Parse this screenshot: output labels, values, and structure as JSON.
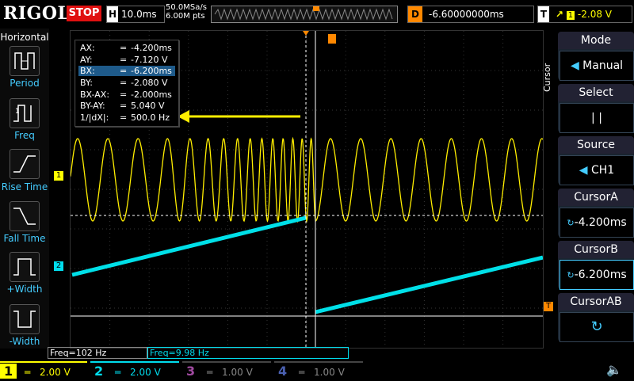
{
  "brand": "RIGOL",
  "run_state": "STOP",
  "timebase": {
    "label": "H",
    "value": "10.0ms"
  },
  "sample": {
    "rate": "50.0MSa/s",
    "points": "6.00M pts"
  },
  "delay": {
    "label": "D",
    "value": "-6.60000000ms"
  },
  "trigger": {
    "label": "T",
    "value": "-2.08 V"
  },
  "left_menu": {
    "title": "Horizontal",
    "items": [
      {
        "label": "Period"
      },
      {
        "label": "Freq"
      },
      {
        "label": "Rise Time"
      },
      {
        "label": "Fall Time"
      },
      {
        "label": "+Width"
      },
      {
        "label": "-Width"
      }
    ]
  },
  "right_menu": {
    "side_label": "Cursor",
    "mode": {
      "title": "Mode",
      "value": "Manual"
    },
    "select": {
      "title": "Select",
      "value": "|   |"
    },
    "source": {
      "title": "Source",
      "value": "CH1"
    },
    "cursor_a": {
      "title": "CursorA",
      "value": "-4.200ms"
    },
    "cursor_b": {
      "title": "CursorB",
      "value": "-6.200ms"
    },
    "cursor_ab": {
      "title": "CursorAB"
    }
  },
  "cursor_readout": [
    {
      "name": "AX:",
      "eq": "=",
      "value": "-4.200ms"
    },
    {
      "name": "AY:",
      "eq": "=",
      "value": "-7.120 V"
    },
    {
      "name": "BX:",
      "eq": "=",
      "value": "-6.200ms"
    },
    {
      "name": "BY:",
      "eq": "=",
      "value": "-2.080 V"
    },
    {
      "name": "BX-AX:",
      "eq": "=",
      "value": "-2.000ms"
    },
    {
      "name": "BY-AY:",
      "eq": "=",
      "value": "5.040 V"
    },
    {
      "name": "1/|dX|:",
      "eq": "=",
      "value": "500.0 Hz"
    }
  ],
  "freq_readouts": [
    {
      "text": "Freq=102 Hz"
    },
    {
      "text": "Freq=9.98 Hz"
    }
  ],
  "channels": [
    {
      "num": "1",
      "scale": "2.00 V",
      "color": "#ffee00"
    },
    {
      "num": "2",
      "scale": "2.00 V",
      "color": "#00e0e8"
    },
    {
      "num": "3",
      "scale": "1.00 V",
      "color": "#e040e0"
    },
    {
      "num": "4",
      "scale": "1.00 V",
      "color": "#3060ff"
    }
  ],
  "markers": {
    "ch1": "1",
    "ch2": "2",
    "trigger": "T"
  },
  "colors": {
    "ch1": "#ffee00",
    "ch2": "#00e0e8",
    "cursor": "#ffffff",
    "trigger": "#ff8800",
    "accent": "#1e5a8a",
    "stop": "#e01010"
  }
}
